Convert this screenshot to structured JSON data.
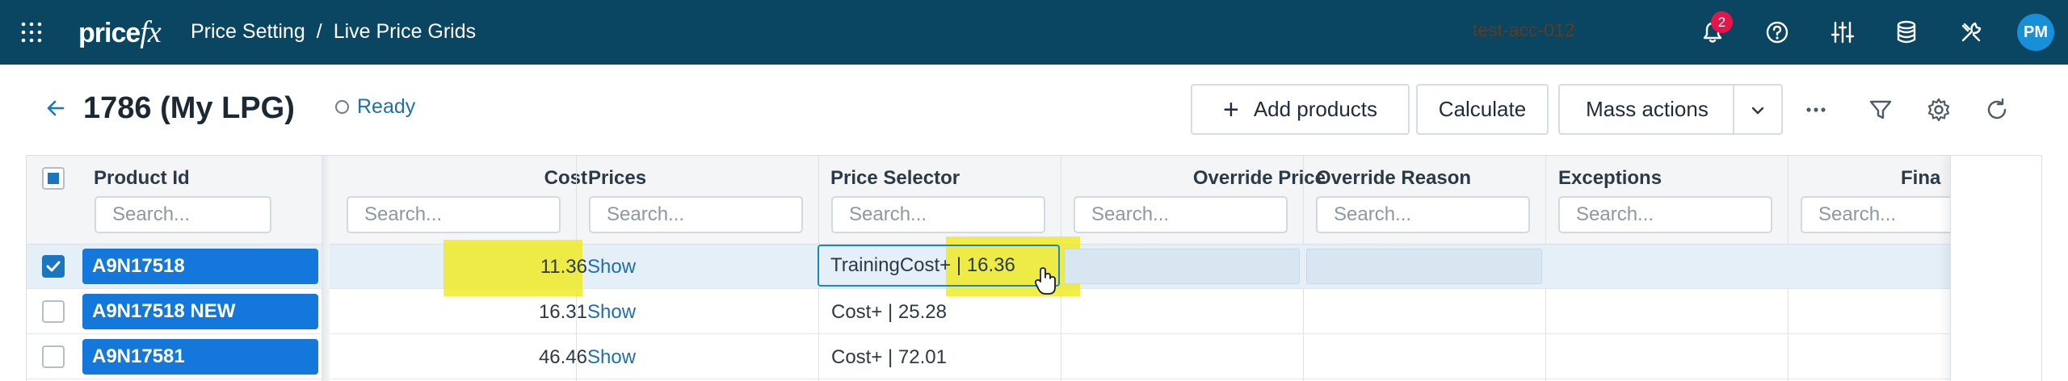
{
  "topbar": {
    "logo_text": "price",
    "logo_suffix": "fx",
    "breadcrumb_1": "Price Setting",
    "breadcrumb_sep": "/",
    "breadcrumb_2": "Live Price Grids",
    "account": "test-acc-012",
    "notification_count": "2",
    "avatar_initials": "PM",
    "icons": [
      "apps-grid-icon",
      "bell-icon",
      "help-icon",
      "sliders-icon",
      "database-icon",
      "tools-icon"
    ]
  },
  "page": {
    "title": "1786 (My LPG)",
    "status": "Ready"
  },
  "toolbar": {
    "add_products": "Add products",
    "calculate": "Calculate",
    "mass_actions": "Mass actions"
  },
  "table": {
    "columns": [
      "Product Id",
      "Cost",
      "Prices",
      "Price Selector",
      "Override Price",
      "Override Reason",
      "Exceptions",
      "Fina"
    ],
    "search_placeholder": "Search...",
    "rows": [
      {
        "product_id": "A9N17518",
        "cost": "11.36",
        "prices": "Show",
        "price_selector": "TrainingCost+ | 16.36",
        "selected": true
      },
      {
        "product_id": "A9N17518 NEW",
        "cost": "16.31",
        "prices": "Show",
        "price_selector": "Cost+ | 25.28",
        "selected": false
      },
      {
        "product_id": "A9N17581",
        "cost": "46.46",
        "prices": "Show",
        "price_selector": "Cost+ | 72.01",
        "selected": false
      }
    ]
  },
  "colors": {
    "topbar": "#0a4561",
    "accent": "#1477dc",
    "highlight": "#f0ea28",
    "badge": "#e3154b"
  }
}
